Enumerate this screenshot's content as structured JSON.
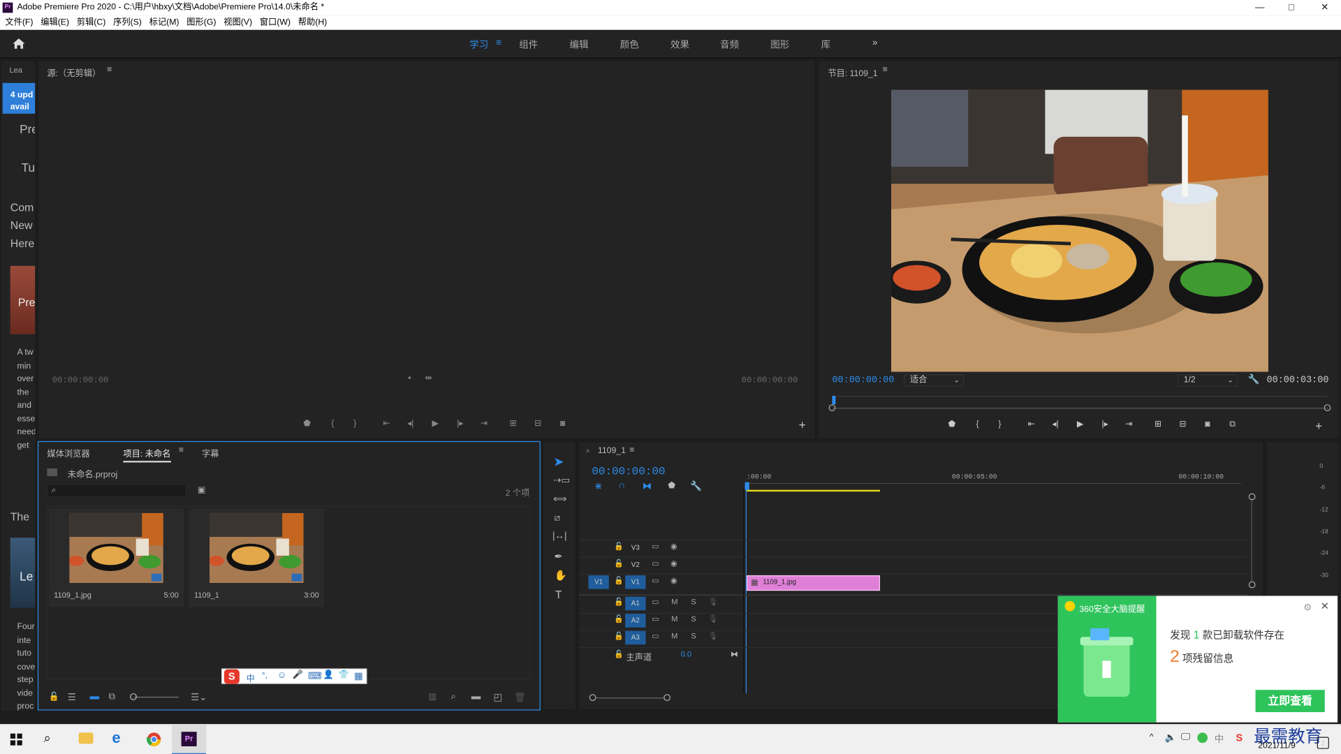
{
  "window": {
    "title": "Adobe Premiere Pro 2020 - C:\\用户\\hbxy\\文档\\Adobe\\Premiere Pro\\14.0\\未命名 *",
    "app_icon": "Pr",
    "controls": {
      "minimize": "—",
      "maximize": "□",
      "close": "✕"
    }
  },
  "menu": [
    "文件(F)",
    "编辑(E)",
    "剪辑(C)",
    "序列(S)",
    "标记(M)",
    "图形(G)",
    "视图(V)",
    "窗口(W)",
    "帮助(H)"
  ],
  "workspaces": {
    "tabs": [
      "学习",
      "组件",
      "编辑",
      "颜色",
      "效果",
      "音频",
      "图形",
      "库"
    ],
    "active": "学习",
    "more": "»"
  },
  "learn_panel": {
    "tab": "Lea",
    "update_badge": [
      "4 upd",
      "avail"
    ],
    "lines": [
      "Pre",
      "Tu",
      "Com",
      "New",
      "Here",
      "Pre",
      "A tw",
      "min",
      "over",
      "the",
      "and",
      "esse",
      "need",
      "get",
      "The",
      "Le",
      "Four",
      "inte",
      "tuto",
      "cove",
      "step",
      "vide",
      "proc"
    ]
  },
  "source_monitor": {
    "title": "源:（无剪辑）",
    "tc_in": "00:00:00:00",
    "tc_out": "00:00:00:00"
  },
  "program_monitor": {
    "title": "节目: 1109_1",
    "tc_current": "00:00:00:00",
    "fit": "适合",
    "resolution": "1/2",
    "tc_duration": "00:00:03:00"
  },
  "project_panel": {
    "tabs": [
      "媒体浏览器",
      "项目: 未命名",
      "字幕"
    ],
    "active_tab": "项目: 未命名",
    "file": "未命名.prproj",
    "search_placeholder": "",
    "item_count": "2 个项",
    "items": [
      {
        "name": "1109_1.jpg",
        "duration": "5:00"
      },
      {
        "name": "1109_1",
        "duration": "3:00"
      }
    ]
  },
  "timeline": {
    "tab": "1109_1",
    "tc": "00:00:00:00",
    "ruler": [
      ":00:00",
      "00:00:05:00",
      "00:00:10:00"
    ],
    "video_tracks": [
      "V3",
      "V2",
      "V1"
    ],
    "audio_tracks": [
      "A1",
      "A2",
      "A3"
    ],
    "source_patch": "V1",
    "master": {
      "label": "主声道",
      "value": "0.0"
    },
    "clip": {
      "name": "1109_1.jpg"
    },
    "audio_flags": {
      "m": "M",
      "s": "S"
    }
  },
  "meter_scale": [
    "0",
    "-6",
    "-12",
    "-18",
    "-24",
    "-30"
  ],
  "ime_bar": {
    "logo": "S",
    "items": [
      "中",
      "°,",
      "☺",
      "🎤",
      "⌨",
      "👤",
      "👕",
      "▦"
    ]
  },
  "toast": {
    "header": "360安全大脑提醒",
    "line1_prefix": "发现",
    "line1_count": "1",
    "line1_suffix": "款已卸载软件存在",
    "line2_count": "2",
    "line2_suffix": "项残留信息",
    "button": "立即查看"
  },
  "taskbar": {
    "date": "2021/11/9",
    "watermark": "最需教育",
    "tray_number": "2",
    "apps": [
      "windows-start",
      "search",
      "file-explorer",
      "edge",
      "chrome",
      "premiere"
    ]
  },
  "colors": {
    "accent": "#2d8ceb",
    "clip": "#e07fd8",
    "workarea": "#e5d51d",
    "toast_green": "#2fc35c",
    "toast_number": "#2fc35c"
  }
}
